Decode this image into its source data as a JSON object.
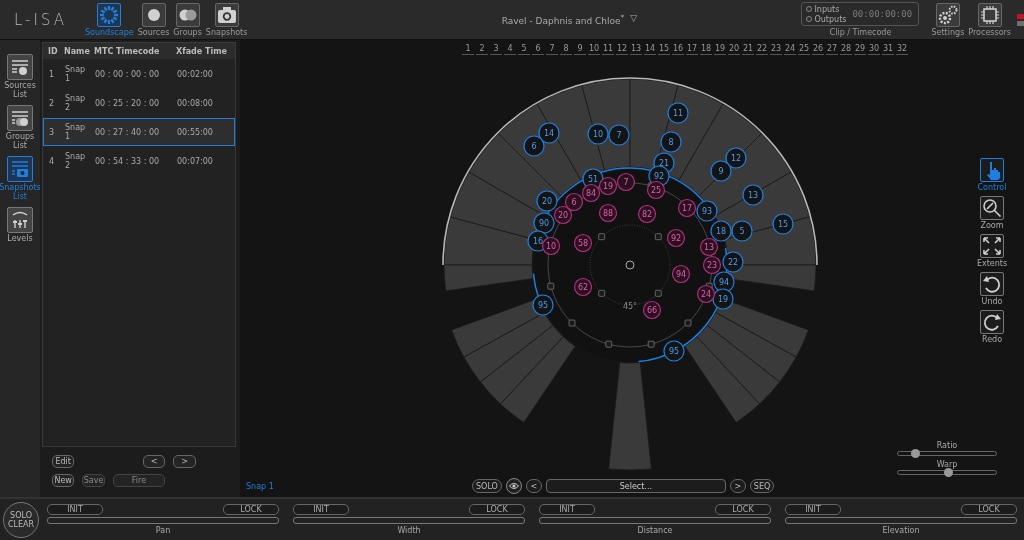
{
  "logo": "L-ISA",
  "top_tabs": [
    {
      "label": "Soundscape",
      "kind": "soundscape",
      "selected": true
    },
    {
      "label": "Sources",
      "kind": "sources",
      "selected": false
    },
    {
      "label": "Groups",
      "kind": "groups",
      "selected": false
    },
    {
      "label": "Snapshots",
      "kind": "snapshots",
      "selected": false
    }
  ],
  "project": {
    "title": "Ravel - Daphnis and Chloe$^{*}$",
    "menu_glyph": "▽"
  },
  "clip_timecode": {
    "options": [
      {
        "label": "Inputs",
        "selected": false
      },
      {
        "label": "Outputs",
        "selected": false
      }
    ],
    "timecode": "00:00:00:00",
    "label": "Clip / Timecode"
  },
  "top_buttons": [
    {
      "label": "Settings",
      "kind": "settings"
    },
    {
      "label": "Processors",
      "kind": "processor"
    }
  ],
  "status_indicators": [
    {
      "color": "#c0142a"
    },
    {
      "color": "#6e6e6e"
    }
  ],
  "side_nav": [
    {
      "label": "Sources List",
      "kind": "sources",
      "selected": false
    },
    {
      "label": "Groups List",
      "kind": "groups",
      "selected": false
    },
    {
      "label": "Snapshots List",
      "kind": "snapshots",
      "selected": true
    },
    {
      "label": "Levels",
      "kind": "levels",
      "selected": false
    }
  ],
  "snapshots": {
    "columns": [
      "ID",
      "Name",
      "MTC Timecode",
      "Xfade Time"
    ],
    "rows": [
      {
        "id": "1",
        "name": "Snap 1",
        "timecode": "00 : 00 : 00 : 00",
        "xfade": "00:02:00",
        "selected": false
      },
      {
        "id": "2",
        "name": "Snap 2",
        "timecode": "00 : 25 : 20 : 00",
        "xfade": "00:08:00",
        "selected": false
      },
      {
        "id": "3",
        "name": "Snap 1",
        "timecode": "00 : 27 : 40 : 00",
        "xfade": "00:55:00",
        "selected": true
      },
      {
        "id": "4",
        "name": "Snap 2",
        "timecode": "00 : 54 : 33 : 00",
        "xfade": "00:07:00",
        "selected": false
      }
    ]
  },
  "snapshot_buttons": [
    {
      "label": "Edit",
      "disabled": false
    },
    {
      "label": "<",
      "disabled": false
    },
    {
      "label": ">",
      "disabled": false
    },
    {
      "label": "New",
      "disabled": false
    },
    {
      "label": "Save",
      "disabled": true
    },
    {
      "label": "Fire",
      "disabled": true
    }
  ],
  "timeline": [
    "1",
    "2",
    "3",
    "4",
    "5",
    "6",
    "7",
    "8",
    "9",
    "10",
    "11",
    "12",
    "13",
    "14",
    "15",
    "16",
    "17",
    "18",
    "19",
    "20",
    "21",
    "22",
    "23",
    "24",
    "25",
    "26",
    "27",
    "28",
    "29",
    "30",
    "31",
    "32"
  ],
  "soundscape": {
    "angle_label": "45°",
    "sources": [
      {
        "label": "14",
        "color": "#1e7fe0"
      },
      {
        "label": "6",
        "color": "#1e7fe0"
      },
      {
        "label": "10",
        "color": "#1e7fe0"
      },
      {
        "label": "7",
        "color": "#1e7fe0"
      },
      {
        "label": "11",
        "color": "#1e7fe0"
      },
      {
        "label": "8",
        "color": "#1e7fe0"
      },
      {
        "label": "21",
        "color": "#1e7fe0"
      },
      {
        "label": "12",
        "color": "#1e7fe0"
      },
      {
        "label": "9",
        "color": "#1e7fe0"
      },
      {
        "label": "92",
        "color": "#1e7fe0"
      },
      {
        "label": "51",
        "color": "#1e7fe0"
      },
      {
        "label": "13",
        "color": "#1e7fe0"
      },
      {
        "label": "20",
        "color": "#1e7fe0"
      },
      {
        "label": "93",
        "color": "#1e7fe0"
      },
      {
        "label": "18",
        "color": "#1e7fe0"
      },
      {
        "label": "5",
        "color": "#1e7fe0"
      },
      {
        "label": "15",
        "color": "#1e7fe0"
      },
      {
        "label": "90",
        "color": "#1e7fe0"
      },
      {
        "label": "16",
        "color": "#1e7fe0"
      },
      {
        "label": "22",
        "color": "#1e7fe0"
      },
      {
        "label": "94",
        "color": "#1e7fe0"
      },
      {
        "label": "19",
        "color": "#1e7fe0"
      },
      {
        "label": "95",
        "color": "#1e7fe0"
      },
      {
        "label": "95",
        "color": "#1e7fe0"
      },
      {
        "label": "19",
        "color": "#b0307a"
      },
      {
        "label": "7",
        "color": "#b0307a"
      },
      {
        "label": "25",
        "color": "#b0307a"
      },
      {
        "label": "17",
        "color": "#b0307a"
      },
      {
        "label": "20",
        "color": "#b0307a"
      },
      {
        "label": "6",
        "color": "#b0307a"
      },
      {
        "label": "84",
        "color": "#b0307a"
      },
      {
        "label": "88",
        "color": "#b0307a"
      },
      {
        "label": "82",
        "color": "#b0307a"
      },
      {
        "label": "58",
        "color": "#b0307a"
      },
      {
        "label": "92",
        "color": "#b0307a"
      },
      {
        "label": "10",
        "color": "#b0307a"
      },
      {
        "label": "94",
        "color": "#b0307a"
      },
      {
        "label": "62",
        "color": "#b0307a"
      },
      {
        "label": "66",
        "color": "#b0307a"
      },
      {
        "label": "24",
        "color": "#b0307a"
      },
      {
        "label": "23",
        "color": "#b0307a"
      },
      {
        "label": "13",
        "color": "#b0307a"
      }
    ]
  },
  "current_snapshot": "Snap 1",
  "transport": {
    "solo": "SOLO",
    "prev": "<",
    "select": "Select...",
    "next": ">",
    "seq": "SEQ"
  },
  "view_tools": [
    {
      "label": "Control",
      "kind": "control",
      "selected": true
    },
    {
      "label": "Zoom",
      "kind": "zoom",
      "selected": false
    },
    {
      "label": "Extents",
      "kind": "extents",
      "selected": false
    },
    {
      "label": "Undo",
      "kind": "undo",
      "selected": false
    },
    {
      "label": "Redo",
      "kind": "redo",
      "selected": false
    }
  ],
  "sliders": [
    {
      "label": "Ratio",
      "level": 0.18
    },
    {
      "label": "Warp",
      "level": 0.52
    }
  ],
  "solo_clear": "SOLO CLEAR",
  "parameters": [
    {
      "label": "Pan",
      "init": "INIT",
      "lock": "LOCK",
      "level": 0
    },
    {
      "label": "Width",
      "init": "INIT",
      "lock": "LOCK",
      "level": 0
    },
    {
      "label": "Distance",
      "init": "INIT",
      "lock": "LOCK",
      "level": 0
    },
    {
      "label": "Elevation",
      "init": "INIT",
      "lock": "LOCK",
      "level": 0
    }
  ]
}
